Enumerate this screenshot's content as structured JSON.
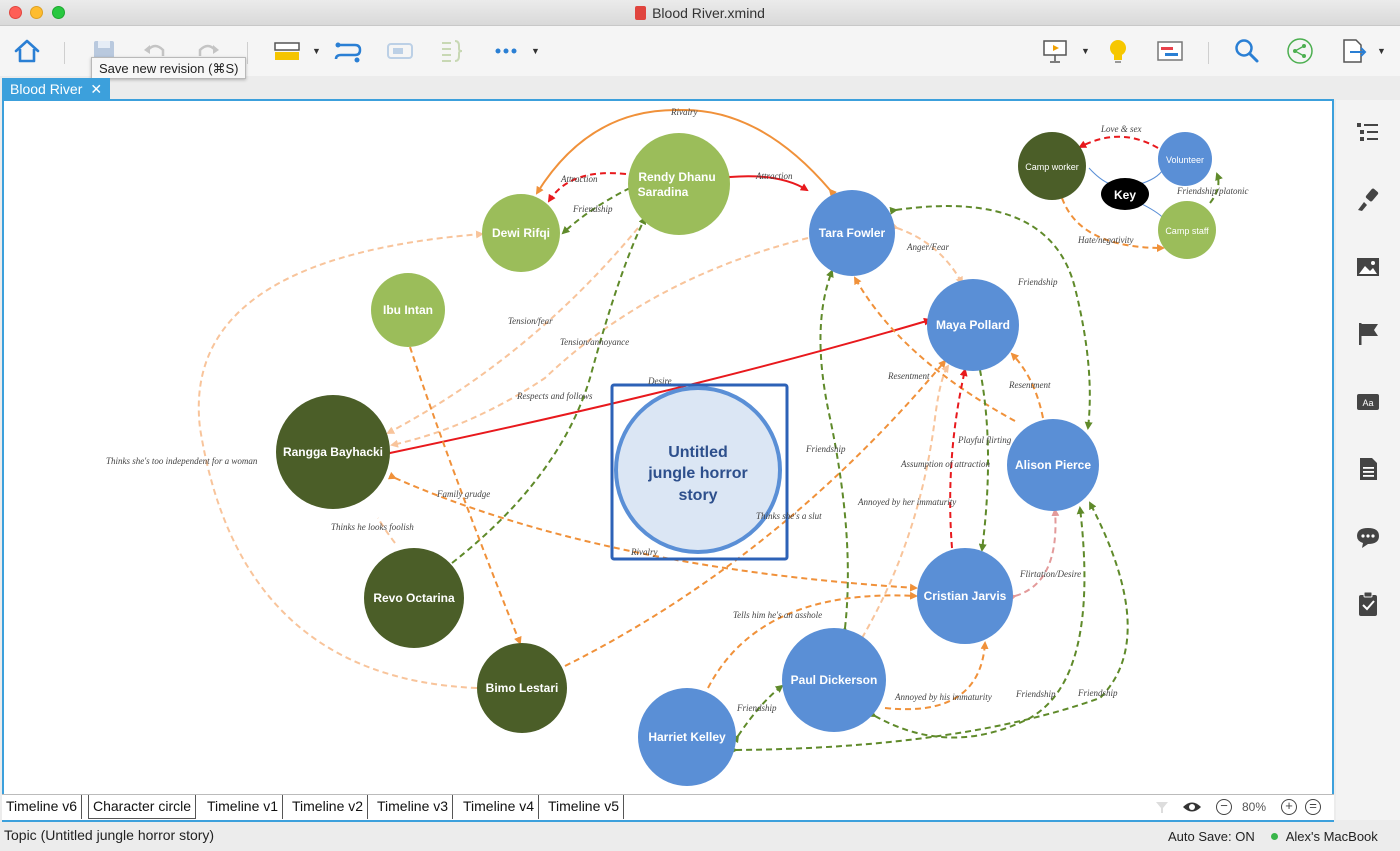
{
  "window": {
    "title": "Blood River.xmind"
  },
  "tooltip": "Save new revision (⌘S)",
  "doc_tab": {
    "label": "Blood River",
    "close": "✕"
  },
  "central_topic": {
    "line1": "Untitled",
    "line2": "jungle horror",
    "line3": "story"
  },
  "nodes": {
    "rendy": {
      "line1": "Rendy Dhanu",
      "line2": "Saradina"
    },
    "dewi": "Dewi Rifqi",
    "ibu": "Ibu Intan",
    "rangga": "Rangga Bayhacki",
    "revo": "Revo Octarina",
    "bimo": "Bimo Lestari",
    "tara": "Tara Fowler",
    "maya": "Maya Pollard",
    "alison": "Alison Pierce",
    "cristian": "Cristian Jarvis",
    "paul": "Paul Dickerson",
    "harriet": "Harriet Kelley"
  },
  "key": {
    "center": "Key",
    "camp_worker": "Camp worker",
    "volunteer": "Volunteer",
    "camp_staff": "Camp staff",
    "love": "Love & sex",
    "friendship": "Friendship/platonic",
    "hate": "Hate/negativity"
  },
  "relations": {
    "rivalry_top": "Rivalry",
    "attraction_1": "Attraction",
    "attraction_2": "Attraction",
    "friendship_dr": "Friendship",
    "tension_fear": "Tension/fear",
    "tension_annoyance": "Tension/annoyance",
    "respects": "Respects and follows",
    "desire": "Desire",
    "independent": "Thinks she's too independent for a woman",
    "family": "Family grudge",
    "foolish": "Thinks he looks foolish",
    "rivalry_mid": "Rivalry",
    "slut": "Thinks she's a slut",
    "anger": "Anger/Fear",
    "friendship_ta": "Friendship",
    "resentment_1": "Resentment",
    "resentment_2": "Resentment",
    "playful": "Playful flirting",
    "assumption": "Assumption of attraction",
    "friendship_tp": "Friendship",
    "annoyed_1": "Annoyed by her immaturity",
    "flirtation": "Flirtation/Desire",
    "asshole": "Tells him he's an asshole",
    "annoyed_2": "Annoyed by his immaturity",
    "friendship_hp": "Friendship",
    "friendship_ap": "Friendship",
    "friendship_ah": "Friendship"
  },
  "sheets": [
    "Timeline v6",
    "Character circle",
    "Timeline v1",
    "Timeline v2",
    "Timeline v3",
    "Timeline v4",
    "Timeline v5"
  ],
  "zoom": "80%",
  "status": {
    "topic": "Topic (Untitled jungle horror story)",
    "autosave": "Auto Save: ON",
    "device": "Alex's MacBook"
  },
  "colors": {
    "accent": "#3ca0dc",
    "camp_worker": "#4b5e28",
    "volunteer": "#5a8fd6",
    "camp_staff": "#9bbd5a",
    "love": "#e8191d",
    "friendship": "#5f8a2a",
    "hate": "#f0913a"
  }
}
